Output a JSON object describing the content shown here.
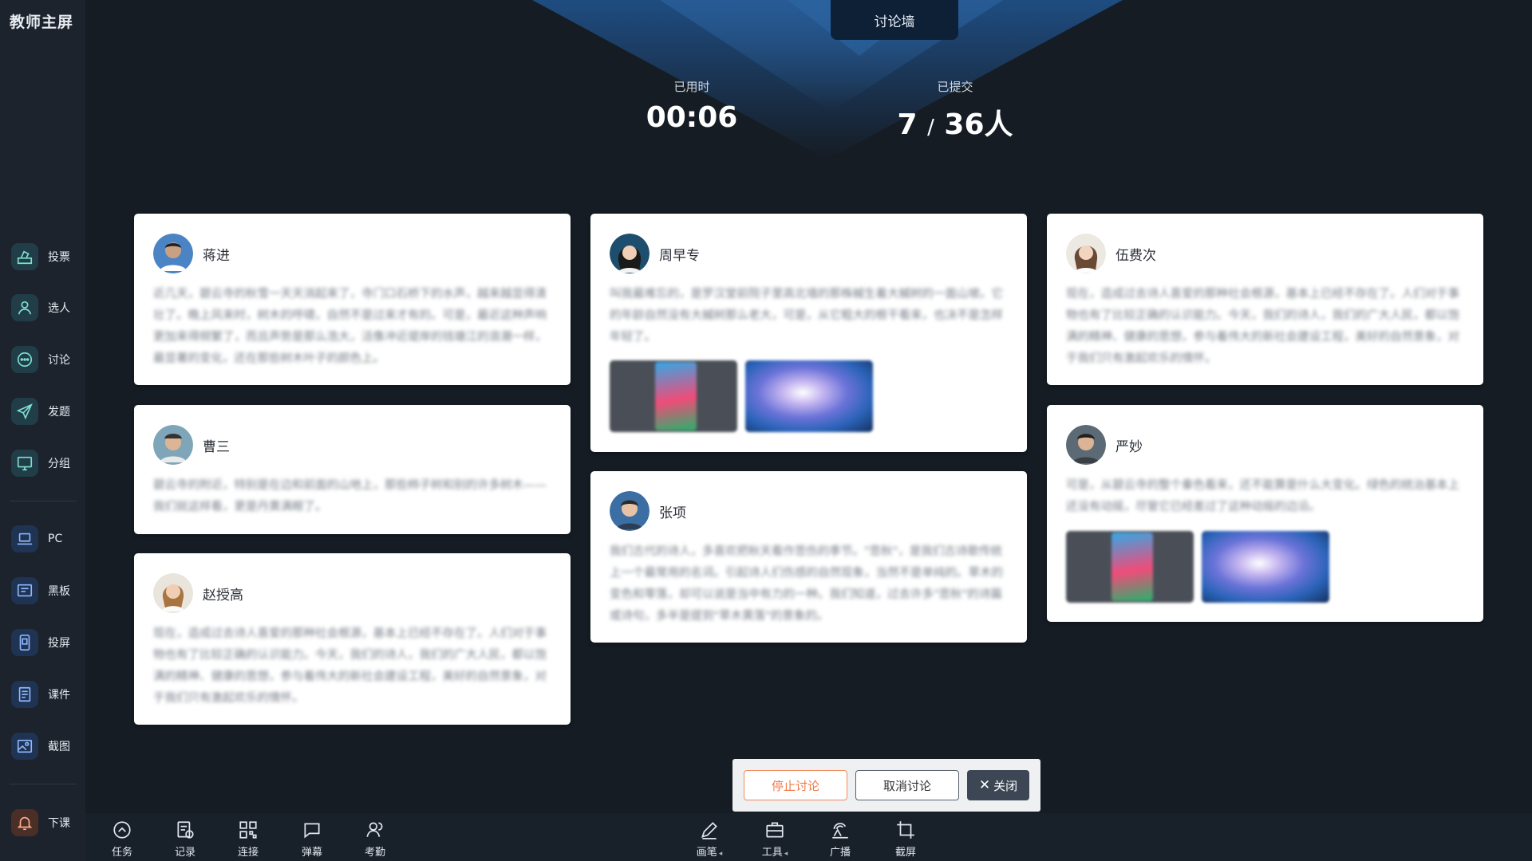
{
  "app": {
    "title": "教师主屏",
    "screen_title": "讨论墙"
  },
  "sidebar": {
    "items": [
      {
        "label": "投票",
        "icon": "vote-icon"
      },
      {
        "label": "选人",
        "icon": "person-icon"
      },
      {
        "label": "讨论",
        "icon": "chat-icon"
      },
      {
        "label": "发题",
        "icon": "send-icon"
      },
      {
        "label": "分组",
        "icon": "monitor-icon"
      },
      {
        "label": "PC",
        "icon": "laptop-icon"
      },
      {
        "label": "黑板",
        "icon": "board-icon"
      },
      {
        "label": "投屏",
        "icon": "cast-icon"
      },
      {
        "label": "课件",
        "icon": "doc-icon"
      },
      {
        "label": "截图",
        "icon": "image-icon"
      },
      {
        "label": "下课",
        "icon": "bell-icon"
      }
    ]
  },
  "stats": {
    "elapsed_label": "已用时",
    "elapsed_value": "00:06",
    "submitted_label": "已提交",
    "submitted_count": "7",
    "submitted_sep": "/",
    "submitted_total": "36人"
  },
  "cards": [
    {
      "name": "蒋进",
      "text": "近几天，碧云寺的秋雪一天天消起来了，寺门口石桥下的水声，越来越显得清壮了。晚上风来时，树木的呼啸，自然不是过来才有的。可是，最近这种声响更加来得频繁了，而且声势是那么浩大，活像冲近堤岸的钱塘江的浪潮一样，最显著的变化，还在那些树木叶子的颜色上。"
    },
    {
      "name": "曹三",
      "text": "碧云寺的附近，特别是在边和前面的山地上，那些柿子树和别的许多树木——我们就这样看，更是丹黄满眼了。"
    },
    {
      "name": "赵授高",
      "text": "现在，造成过去诗人喜爱的那种社会根源，基本上已经不存在了。人们对于事物也有了比较正确的认识能力。今天，我们的诗人，我们的广大人民，都以饱满的精神、健康的思想，参与着伟大的新社会建设工程，美好的自然景象，对于我们只有激起欢乐的情怀。"
    },
    {
      "name": "周早专",
      "text": "叫我最难忘的，是罗汉堂前院子里高北墙的那株槭生着大槭树的一面山坡。它的年龄自然没有大槭树那么老大，可是，从它粗大的根干看来，也决不是怎样年轻了。"
    },
    {
      "name": "张项",
      "text": "我们古代的诗人，多喜欢把秋天看作悲伤的季节。\"悲秋\"，是我们古诗歌传统上一个最常用的名词。引起诗人们伤感的自然现象，当然不是单纯的。草木的变色和零落，却可以说是当中有力的一种。我们知道，过去许多\"悲秋\"的诗篇或诗句，多半是提到\"草木黄落\"的景象的。"
    },
    {
      "name": "伍费次",
      "text": "现在，造成过去诗人喜爱的那种社会根源，基本上已经不存在了。人们对于事物也有了比较正确的认识能力。今天，我们的诗人，我们的广大人民，都以饱满的精神、健康的思想，参与着伟大的新社会建设工程，美好的自然景象，对于我们只有激起欢乐的情怀。"
    },
    {
      "name": "严妙",
      "text": "可是，从碧云寺的整个秦色看来，还不能算是什么大变化。绿色的统治基本上还没有动摇，尽管它已经差过了这种动摇的边沿。"
    }
  ],
  "actions": {
    "stop": "停止讨论",
    "cancel": "取消讨论",
    "close": "关闭"
  },
  "toolbar": {
    "left": [
      "任务",
      "记录",
      "连接",
      "弹幕",
      "考勤"
    ],
    "right": [
      "画笔",
      "工具",
      "广播",
      "截屏"
    ]
  },
  "colors": {
    "accent_orange": "#f07a45",
    "background": "#161c24",
    "sidebar": "#1c232d"
  }
}
